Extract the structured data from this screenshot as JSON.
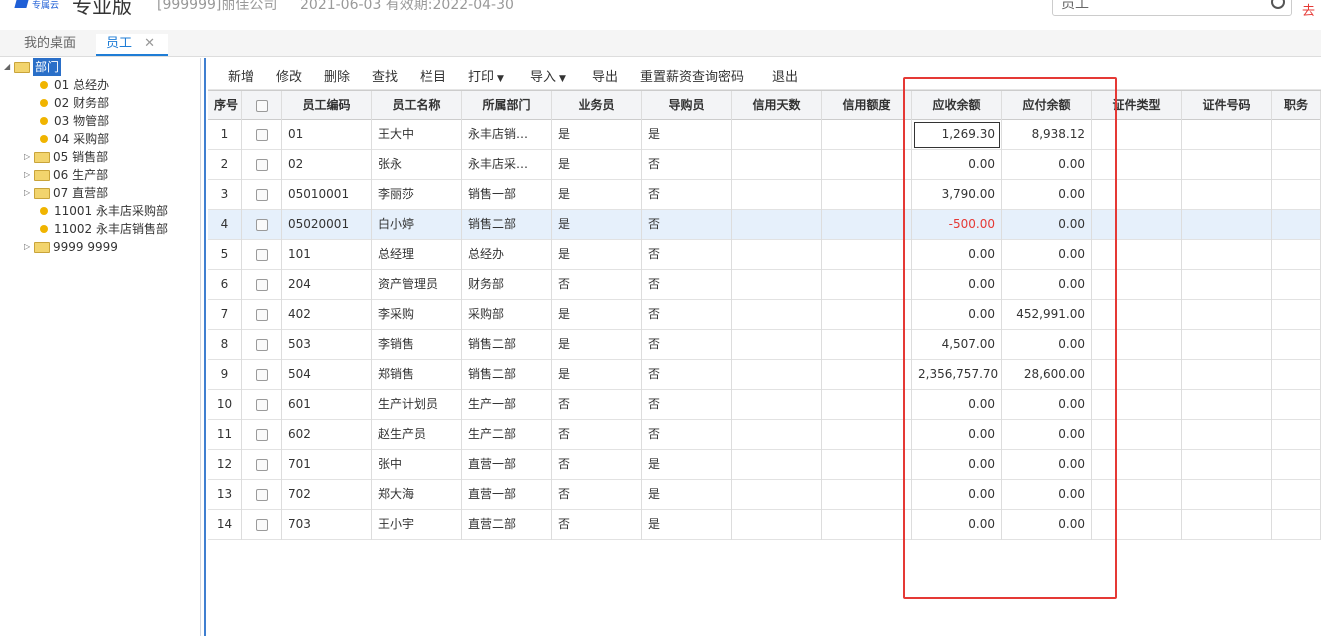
{
  "header": {
    "logo_small": "专属云",
    "edition": "专业版",
    "company": "[999999]丽佳公司",
    "dates": "2021-06-03   有效期:2022-04-30",
    "search_value": "员工",
    "go_link": "去"
  },
  "tabs": {
    "home": "我的桌面",
    "employee": "员工",
    "close": "✕"
  },
  "tree": {
    "root": "部门",
    "nodes": [
      {
        "label": "01 总经办",
        "type": "leaf"
      },
      {
        "label": "02 财务部",
        "type": "leaf"
      },
      {
        "label": "03 物管部",
        "type": "leaf"
      },
      {
        "label": "04 采购部",
        "type": "leaf"
      },
      {
        "label": "05 销售部",
        "type": "folder"
      },
      {
        "label": "06 生产部",
        "type": "folder"
      },
      {
        "label": "07 直营部",
        "type": "folder"
      },
      {
        "label": "11001 永丰店采购部",
        "type": "leaf"
      },
      {
        "label": "11002 永丰店销售部",
        "type": "leaf"
      },
      {
        "label": "9999 9999",
        "type": "folder"
      }
    ]
  },
  "toolbar": {
    "add": "新增",
    "edit": "修改",
    "delete": "删除",
    "find": "查找",
    "columns": "栏目",
    "print": "打印",
    "import": "导入",
    "export": "导出",
    "reset_pwd": "重置薪资查询密码",
    "exit": "退出"
  },
  "grid": {
    "headers": [
      "序号",
      "",
      "员工编码",
      "员工名称",
      "所属部门",
      "业务员",
      "导购员",
      "信用天数",
      "信用额度",
      "应收余额",
      "应付余额",
      "证件类型",
      "证件号码",
      "职务"
    ],
    "rows": [
      [
        "1",
        "01",
        "王大中",
        "永丰店销…",
        "是",
        "是",
        "",
        "",
        "1,269.30",
        "8,938.12",
        "",
        ""
      ],
      [
        "2",
        "02",
        "张永",
        "永丰店采…",
        "是",
        "否",
        "",
        "",
        "0.00",
        "0.00",
        "",
        ""
      ],
      [
        "3",
        "05010001",
        "李丽莎",
        "销售一部",
        "是",
        "否",
        "",
        "",
        "3,790.00",
        "0.00",
        "",
        ""
      ],
      [
        "4",
        "05020001",
        "白小婷",
        "销售二部",
        "是",
        "否",
        "",
        "",
        "-500.00",
        "0.00",
        "",
        ""
      ],
      [
        "5",
        "101",
        "总经理",
        "总经办",
        "是",
        "否",
        "",
        "",
        "0.00",
        "0.00",
        "",
        ""
      ],
      [
        "6",
        "204",
        "资产管理员",
        "财务部",
        "否",
        "否",
        "",
        "",
        "0.00",
        "0.00",
        "",
        ""
      ],
      [
        "7",
        "402",
        "李采购",
        "采购部",
        "是",
        "否",
        "",
        "",
        "0.00",
        "452,991.00",
        "",
        ""
      ],
      [
        "8",
        "503",
        "李销售",
        "销售二部",
        "是",
        "否",
        "",
        "",
        "4,507.00",
        "0.00",
        "",
        ""
      ],
      [
        "9",
        "504",
        "郑销售",
        "销售二部",
        "是",
        "否",
        "",
        "",
        "2,356,757.70",
        "28,600.00",
        "",
        ""
      ],
      [
        "10",
        "601",
        "生产计划员",
        "生产一部",
        "否",
        "否",
        "",
        "",
        "0.00",
        "0.00",
        "",
        ""
      ],
      [
        "11",
        "602",
        "赵生产员",
        "生产二部",
        "否",
        "否",
        "",
        "",
        "0.00",
        "0.00",
        "",
        ""
      ],
      [
        "12",
        "701",
        "张中",
        "直营一部",
        "否",
        "是",
        "",
        "",
        "0.00",
        "0.00",
        "",
        ""
      ],
      [
        "13",
        "702",
        "郑大海",
        "直营一部",
        "否",
        "是",
        "",
        "",
        "0.00",
        "0.00",
        "",
        ""
      ],
      [
        "14",
        "703",
        "王小宇",
        "直营二部",
        "否",
        "是",
        "",
        "",
        "0.00",
        "0.00",
        "",
        ""
      ]
    ],
    "selected_row": 4,
    "negative_color": "#e53935"
  },
  "colors": {
    "accent": "#1f7dd6",
    "highlight_box": "#e53935",
    "selected_row": "#e6f0fb"
  }
}
